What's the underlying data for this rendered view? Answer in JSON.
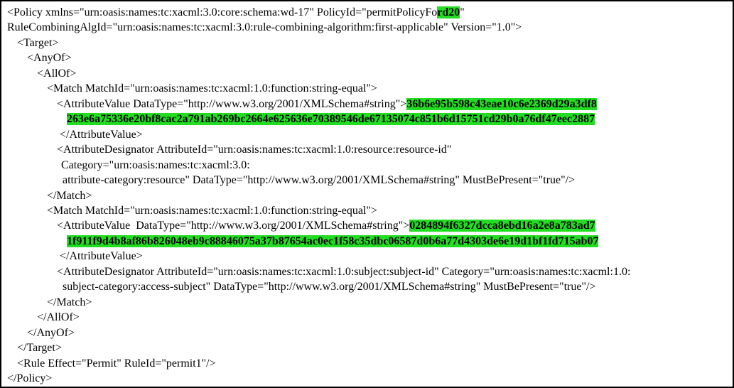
{
  "document": {
    "highlight_color": "#22dd22",
    "lines": [
      {
        "parts": [
          {
            "t": "<Policy xmlns=\"urn:oasis:names:tc:xacml:3.0:core:schema:wd-17\" PolicyId=\"permitPolicyFo"
          },
          {
            "t": "rd20",
            "hl": true
          },
          {
            "t": "\""
          }
        ]
      },
      {
        "parts": [
          {
            "t": "RuleCombiningAlgId=\"urn:oasis:names:tc:xacml:3.0:rule-combining-algorithm:first-applicable\" Version=\"1.0\">"
          }
        ]
      },
      {
        "parts": [
          {
            "t": "<Target>"
          }
        ]
      },
      {
        "parts": [
          {
            "t": "<AnyOf>"
          }
        ]
      },
      {
        "parts": [
          {
            "t": "<AllOf>"
          }
        ]
      },
      {
        "parts": [
          {
            "t": "<Match MatchId=\"urn:oasis:names:tc:xacml:1.0:function:string-equal\">"
          }
        ]
      },
      {
        "parts": [
          {
            "t": "<AttributeValue DataType=\"http://www.w3.org/2001/XMLSchema#string\">"
          },
          {
            "t": "36b6e95b598c43eae10c6e2369d29a3df8",
            "hl": true
          }
        ]
      },
      {
        "parts": [
          {
            "t": "263e6a75336e20bf8cac2a791ab269bc2664e625636e70389546de67135074c851b6d15751cd29b0a76df47eec2887",
            "hl": true
          }
        ]
      },
      {
        "parts": [
          {
            "t": "</AttributeValue>"
          }
        ]
      },
      {
        "parts": [
          {
            "t": "<AttributeDesignator AttributeId=\"urn:oasis:names:tc:xacml:1.0:resource:resource-id\""
          }
        ]
      },
      {
        "parts": [
          {
            "t": "Category=\"urn:oasis:names:tc:xacml:3.0:"
          }
        ]
      },
      {
        "parts": [
          {
            "t": "attribute-category:resource\" DataType=\"http://www.w3.org/2001/XMLSchema#string\" MustBePresent=\"true\"/>"
          }
        ]
      },
      {
        "parts": [
          {
            "t": "</Match>"
          }
        ]
      },
      {
        "parts": [
          {
            "t": "<Match MatchId=\"urn:oasis:names:tc:xacml:1.0:function:string-equal\">"
          }
        ]
      },
      {
        "parts": [
          {
            "t": "<AttributeValue  DataType=\"http://www.w3.org/2001/XMLSchema#string\">"
          },
          {
            "t": "0284894f6327dcca8ebd16a2e8a783ad7",
            "hl": true
          }
        ]
      },
      {
        "parts": [
          {
            "t": "1f911f9d4b8af86b826048eb9c88846075a37b87654ac0ec1f58c35dbc06587d0b6a77d4303de6e19d1bf1fd715ab07",
            "hl": true
          }
        ]
      },
      {
        "parts": [
          {
            "t": "</AttributeValue>"
          }
        ]
      },
      {
        "parts": [
          {
            "t": "<AttributeDesignator AttributeId=\"urn:oasis:names:tc:xacml:1.0:subject:subject-id\" Category=\"urn:oasis:names:tc:xacml:1.0:"
          }
        ]
      },
      {
        "parts": [
          {
            "t": "subject-category:access-subject\" DataType=\"http://www.w3.org/2001/XMLSchema#string\" MustBePresent=\"true\"/>"
          }
        ]
      },
      {
        "parts": [
          {
            "t": "</Match>"
          }
        ]
      },
      {
        "parts": [
          {
            "t": "</AllOf>"
          }
        ]
      },
      {
        "parts": [
          {
            "t": "</AnyOf>"
          }
        ]
      },
      {
        "parts": [
          {
            "t": "</Target>"
          }
        ]
      },
      {
        "parts": [
          {
            "t": "<Rule Effect=\"Permit\" RuleId=\"permit1\"/>"
          }
        ]
      },
      {
        "parts": [
          {
            "t": "</Policy>"
          }
        ]
      }
    ]
  }
}
